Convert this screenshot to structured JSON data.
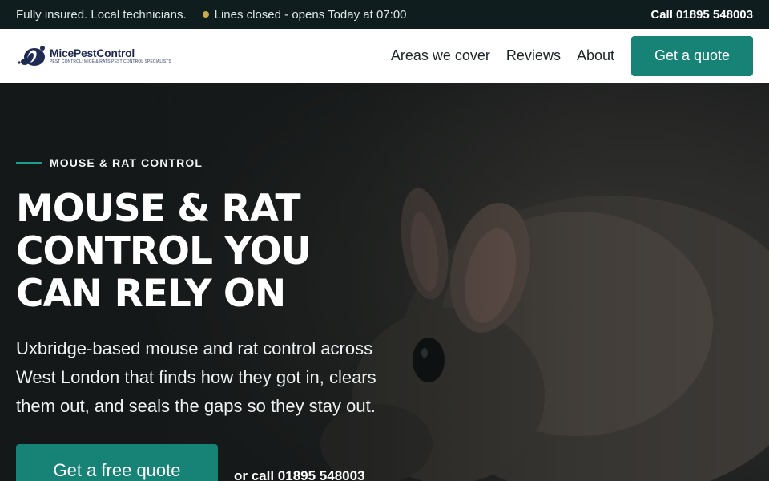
{
  "topbar": {
    "insured_text": "Fully insured. Local technicians.",
    "status_text": "Lines closed - opens Today at 07:00",
    "status_dot_color": "#c9a94a",
    "call_label": "Call 01895 548003"
  },
  "header": {
    "logo": {
      "name": "MicePestControl",
      "tagline": "PEST CONTROL: MICE & RATS PEST CONTROL SPECIALISTS"
    },
    "nav": [
      {
        "label": "Areas we cover"
      },
      {
        "label": "Reviews"
      },
      {
        "label": "About"
      }
    ],
    "cta_label": "Get a quote"
  },
  "hero": {
    "eyebrow": "MOUSE & RAT CONTROL",
    "headline": "MOUSE & RAT CONTROL YOU CAN RELY ON",
    "subcopy": "Uxbridge-based mouse and rat control across West London that finds how they got in, clears them out, and seals the gaps so they stay out.",
    "cta_label": "Get a free quote",
    "call_label": "or call 01895 548003"
  },
  "colors": {
    "accent": "#178276",
    "topbar_bg": "#0f1d1f",
    "brand_navy": "#1e2a52"
  }
}
